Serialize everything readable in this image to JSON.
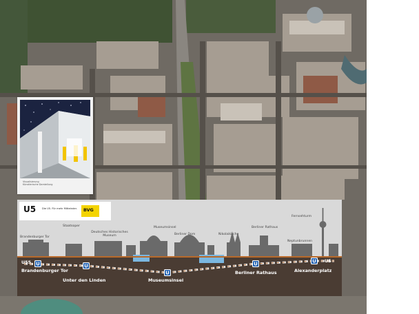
{
  "colors": {
    "panel_bg": "#d9d9d9",
    "ground": "#4a3c33",
    "skyline": "#6a6a6a",
    "station_marker": "#1f5fb0",
    "water": "#7bb7e0",
    "track": "#e9e9e9",
    "bvg_yellow": "#f4d400"
  },
  "photo_card": {
    "caption": "Visualisierung\nKünstlerische Darstellung"
  },
  "route_panel": {
    "logo": {
      "mark": "U5",
      "slogan": "Die U5. Für mehr Mitteinder.",
      "bvg": "BVG"
    },
    "terminals": {
      "left": "U55",
      "right": "U5"
    },
    "landmarks": {
      "brandenburger_tor": "Brandenburger Tor",
      "staatsoper": "Staatsoper",
      "historisches_museum": "Deutsches Historisches Museum",
      "museumsinsel": "Museumsinsel",
      "berliner_dom": "Berliner Dom",
      "nikolaikirche": "Nikolaikirche",
      "berliner_rathaus": "Berliner Rathaus",
      "fernsehturm": "Fernsehturm",
      "neptunbrunnen": "Neptunbrunnen"
    },
    "stations": {
      "brandenburger_tor": "Brandenburger Tor",
      "unter_den_linden": "Unter den Linden",
      "museumsinsel": "Museumsinsel",
      "berliner_rathaus": "Berliner Rathaus",
      "alexanderplatz": "Alexanderplatz"
    },
    "marker_glyph": "U"
  }
}
